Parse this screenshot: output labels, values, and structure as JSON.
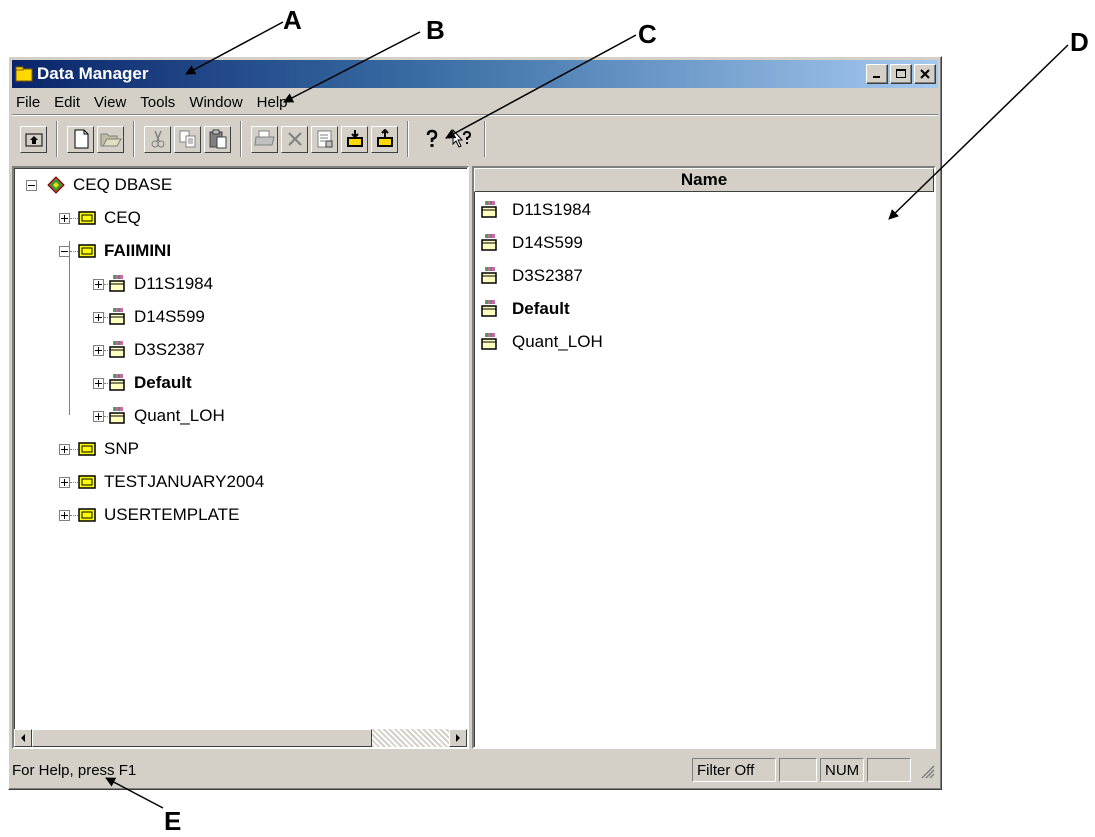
{
  "callouts": [
    "A",
    "B",
    "C",
    "D",
    "E"
  ],
  "window": {
    "title": "Data Manager",
    "caption_buttons": [
      "minimize-icon",
      "maximize-icon",
      "close-icon"
    ]
  },
  "menu": [
    "File",
    "Edit",
    "View",
    "Tools",
    "Window",
    "Help"
  ],
  "toolbar": {
    "groups": [
      [
        "up-folder-icon"
      ],
      [
        "new-icon",
        "open-icon"
      ],
      [
        "cut-icon",
        "copy-icon",
        "paste-icon"
      ],
      [
        "print-icon",
        "delete-icon",
        "properties-icon",
        "import-icon",
        "export-icon"
      ],
      [
        "help-icon",
        "context-help-icon"
      ]
    ]
  },
  "tree": {
    "root": "CEQ DBASE",
    "databases": [
      "CEQ",
      "FAIIMINI",
      "SNP",
      "TESTJANUARY2004",
      "USERTEMPLATE"
    ],
    "expanded": "FAIIMINI",
    "children": [
      "D11S1984",
      "D14S599",
      "D3S2387",
      "Default",
      "Quant_LOH"
    ],
    "bold_child": "Default"
  },
  "list": {
    "column_header": "Name",
    "items": [
      "D11S1984",
      "D14S599",
      "D3S2387",
      "Default",
      "Quant_LOH"
    ],
    "bold_item": "Default"
  },
  "status": {
    "help_text": "For Help, press F1",
    "filter": "Filter Off",
    "num": "NUM"
  },
  "colors": {
    "title_start": "#0a246a",
    "title_end": "#a6caf0",
    "face": "#d4d0c8",
    "db_icon": "#ffff00"
  }
}
